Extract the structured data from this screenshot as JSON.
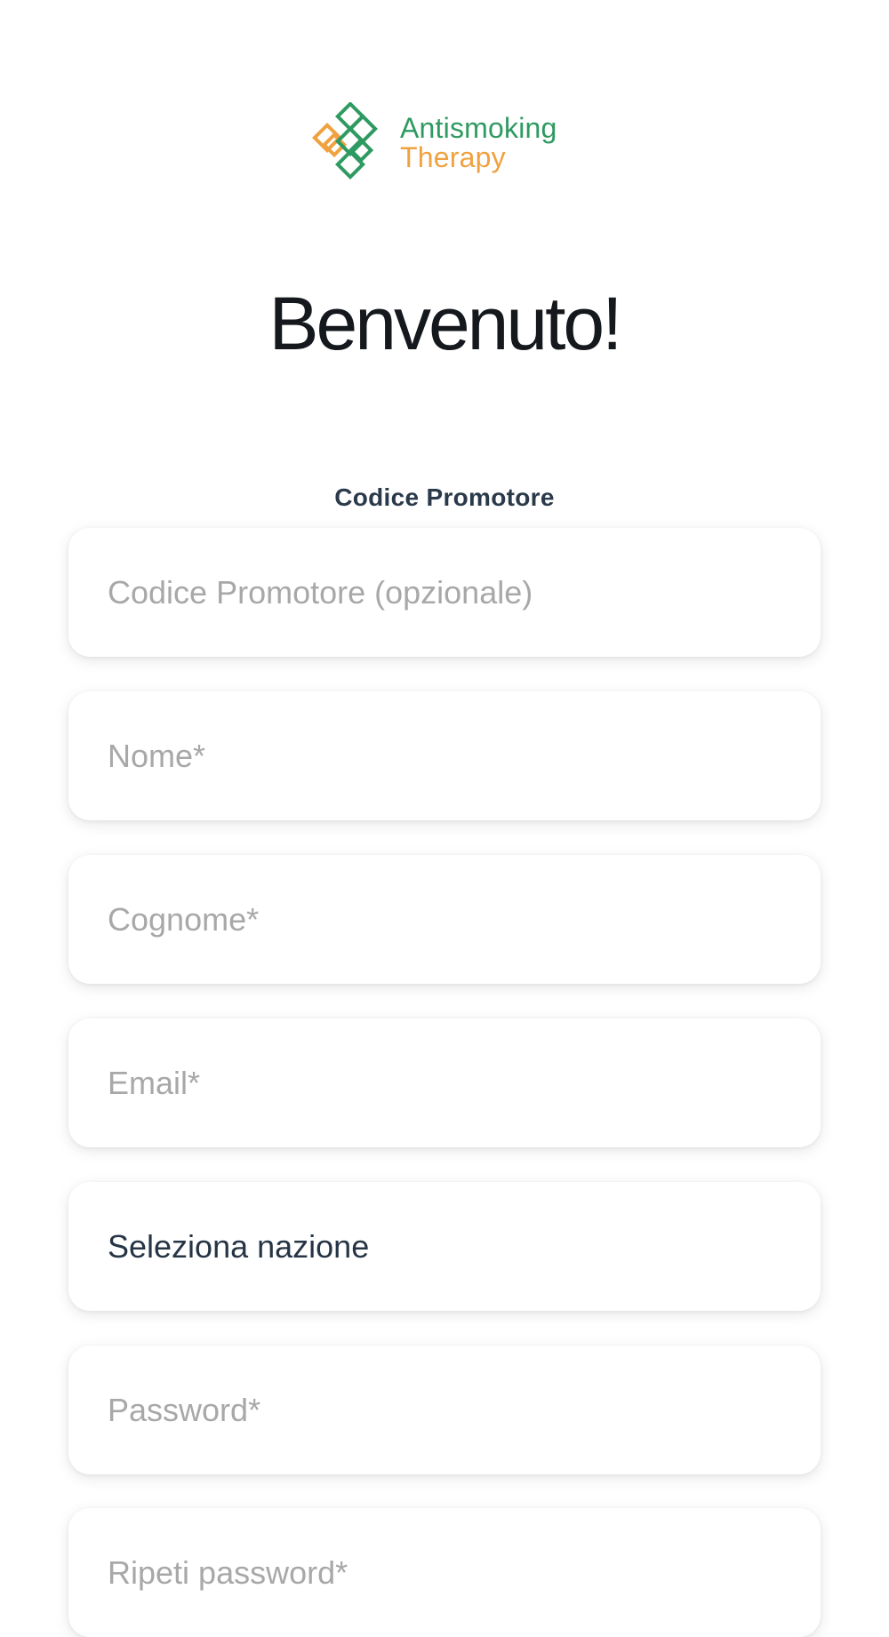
{
  "brand": {
    "line1": "Antismoking",
    "line2": "Therapy",
    "colors": {
      "green": "#2e9a61",
      "orange": "#f0a140"
    }
  },
  "heading": "Benvenuto!",
  "promoter": {
    "label": "Codice Promotore",
    "placeholder": "Codice Promotore (opzionale)"
  },
  "fields": {
    "nome_placeholder": "Nome*",
    "cognome_placeholder": "Cognome*",
    "email_placeholder": "Email*",
    "nation_value": "Seleziona nazione",
    "password_placeholder": "Password*",
    "repeat_password_placeholder": "Ripeti password*"
  }
}
